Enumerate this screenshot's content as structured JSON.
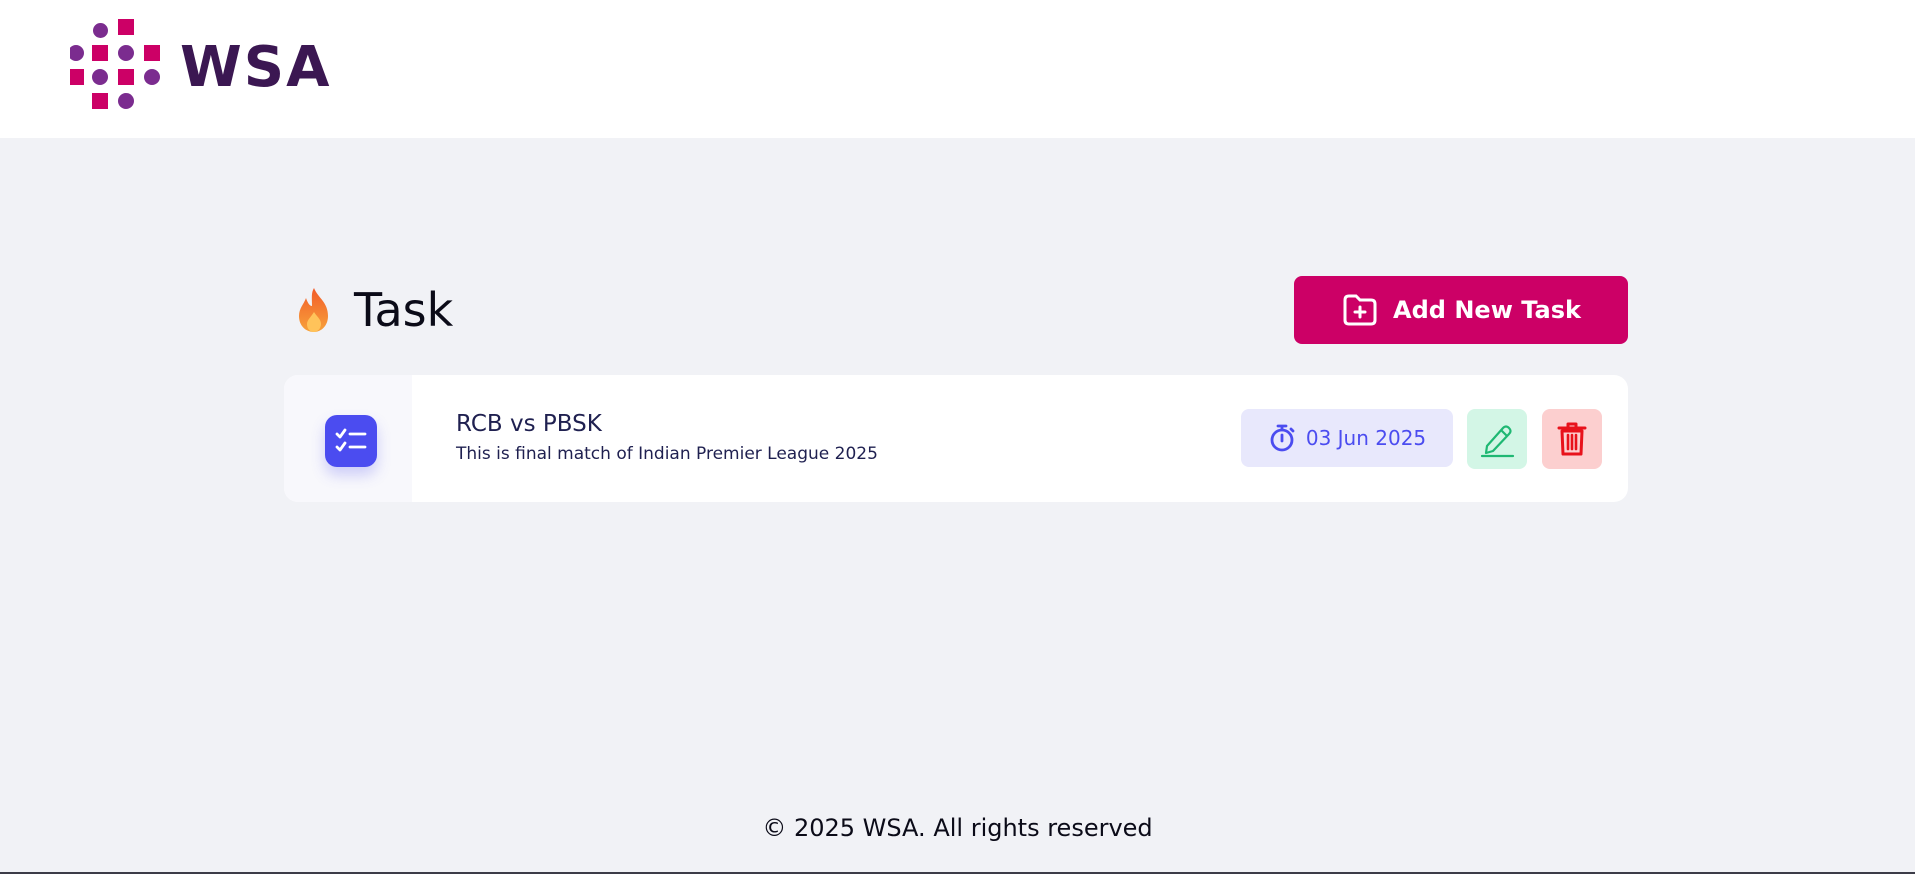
{
  "brand": {
    "logo_text": "WSA",
    "colors": {
      "primary": "#cc0066",
      "dark": "#3b1752",
      "dot_purple": "#7b2c8f"
    }
  },
  "page": {
    "title": "Task",
    "title_icon": "fire-icon"
  },
  "actions": {
    "add_task_label": "Add New Task",
    "add_task_icon": "folder-plus-icon"
  },
  "tasks": [
    {
      "title": "RCB vs PBSK",
      "description": "This is final match of Indian Premier League 2025",
      "date": "03 Jun 2025",
      "icon": "checklist-icon",
      "date_icon": "stopwatch-icon",
      "edit_icon": "pencil-icon",
      "delete_icon": "trash-icon"
    }
  ],
  "footer": {
    "copyright": "© 2025 WSA. All rights reserved"
  }
}
